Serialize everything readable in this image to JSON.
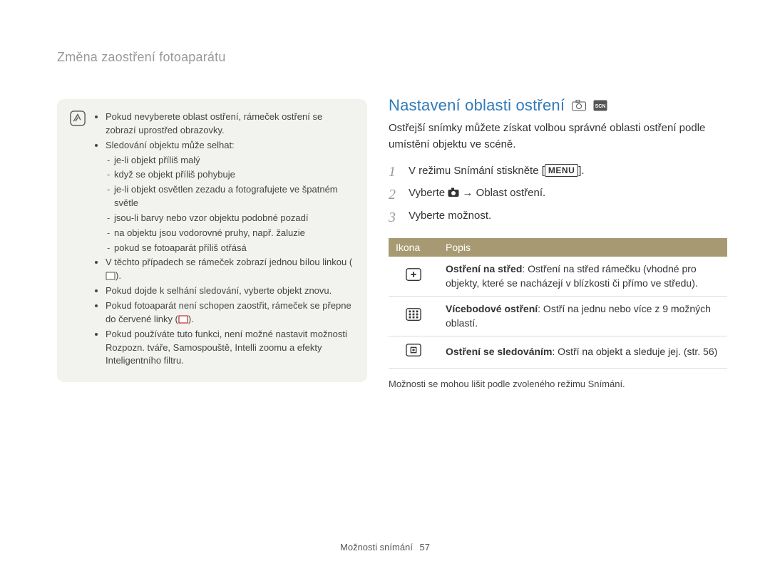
{
  "breadcrumb": "Změna zaostření fotoaparátu",
  "notes": {
    "bullets": [
      "Pokud nevyberete oblast ostření, rámeček ostření se zobrazí uprostřed obrazovky.",
      "Sledování objektu může selhat:",
      "V těchto případech se rámeček zobrazí jednou bílou linkou (",
      "Pokud dojde k selhání sledování, vyberte objekt znovu.",
      "Pokud fotoaparát není schopen zaostřit, rámeček se přepne do červené linky (",
      "Pokud používáte tuto funkci, není možné nastavit možnosti Rozpozn. tváře, Samospouště, Intelli zoomu a efekty Inteligentního ﬁltru."
    ],
    "sub_bullets": [
      "je-li objekt příliš malý",
      "když se objekt příliš pohybuje",
      "je-li objekt osvětlen zezadu a fotografujete ve špatném světle",
      "jsou-li barvy nebo vzor objektu podobné pozadí",
      "na objektu jsou vodorovné pruhy, např. žaluzie",
      "pokud se fotoaparát příliš otřásá"
    ],
    "closing_paren": ")."
  },
  "section": {
    "heading": "Nastavení oblasti ostření",
    "intro": "Ostřejší snímky můžete získat volbou správné oblasti ostření podle umístění objektu ve scéně."
  },
  "steps": {
    "s1_a": "V režimu Snímání stiskněte [",
    "s1_menu": "MENU",
    "s1_b": "].",
    "s2_a": "Vyberte ",
    "s2_b": " → Oblast ostření.",
    "s3": "Vyberte možnost."
  },
  "table": {
    "head_icon": "Ikona",
    "head_desc": "Popis",
    "rows": [
      {
        "desc_strong": "Ostření na střed",
        "desc_rest": ": Ostření na střed rámečku (vhodné pro objekty, které se nacházejí v blízkosti či přímo ve středu)."
      },
      {
        "desc_strong": "Vícebodové ostření",
        "desc_rest": ": Ostří na jednu nebo více z 9 možných oblastí."
      },
      {
        "desc_strong": "Ostření se sledováním",
        "desc_rest": ": Ostří na objekt a sleduje jej. (str. 56)"
      }
    ]
  },
  "table_note": "Možnosti se mohou lišit podle zvoleného režimu Snímání.",
  "footer_label": "Možnosti snímání",
  "footer_page": "57"
}
